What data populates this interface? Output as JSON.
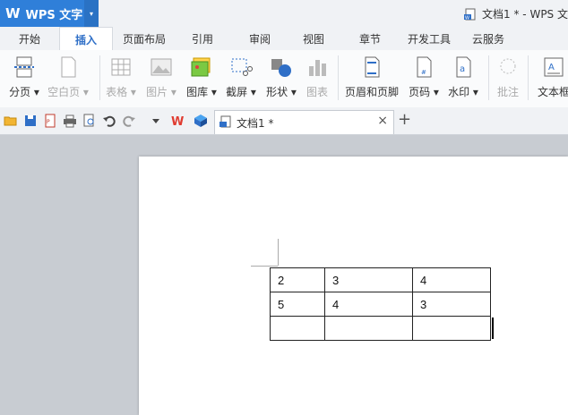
{
  "app": {
    "logo": "W",
    "name": "WPS 文字",
    "document_title": "文档1 * - WPS 文"
  },
  "menu": [
    "开始",
    "插入",
    "页面布局",
    "引用",
    "审阅",
    "视图",
    "章节",
    "开发工具",
    "云服务"
  ],
  "active_menu": "插入",
  "ribbon": [
    {
      "id": "page-break",
      "label": "分页 ▾",
      "icon": "page-break-icon",
      "enabled": true
    },
    {
      "id": "blank-page",
      "label": "空白页 ▾",
      "icon": "blank-page-icon",
      "enabled": false
    },
    {
      "id": "table",
      "label": "表格 ▾",
      "icon": "table-icon",
      "enabled": false
    },
    {
      "id": "picture",
      "label": "图片 ▾",
      "icon": "picture-icon",
      "enabled": false
    },
    {
      "id": "gallery",
      "label": "图库 ▾",
      "icon": "gallery-icon",
      "enabled": true
    },
    {
      "id": "screenshot",
      "label": "截屏 ▾",
      "icon": "screenshot-icon",
      "enabled": true
    },
    {
      "id": "shapes",
      "label": "形状 ▾",
      "icon": "shapes-icon",
      "enabled": true
    },
    {
      "id": "chart",
      "label": "图表",
      "icon": "chart-icon",
      "enabled": false
    },
    {
      "id": "header-footer",
      "label": "页眉和页脚",
      "icon": "header-footer-icon",
      "enabled": true
    },
    {
      "id": "page-number",
      "label": "页码 ▾",
      "icon": "page-number-icon",
      "enabled": true
    },
    {
      "id": "watermark",
      "label": "水印 ▾",
      "icon": "watermark-icon",
      "enabled": true
    },
    {
      "id": "comment",
      "label": "批注",
      "icon": "comment-icon",
      "enabled": false
    },
    {
      "id": "textbox",
      "label": "文本框",
      "icon": "textbox-icon",
      "enabled": true
    }
  ],
  "doc_tab": {
    "label": "文档1 *",
    "close": "×",
    "new_tab": "+"
  },
  "table": {
    "rows": [
      [
        "2",
        "3",
        "4"
      ],
      [
        "5",
        "4",
        "3"
      ],
      [
        "",
        "",
        ""
      ]
    ]
  },
  "colors": {
    "accent": "#2f7fd9",
    "active_tab_text": "#2f6fc7",
    "workspace": "#c8ccd2"
  }
}
